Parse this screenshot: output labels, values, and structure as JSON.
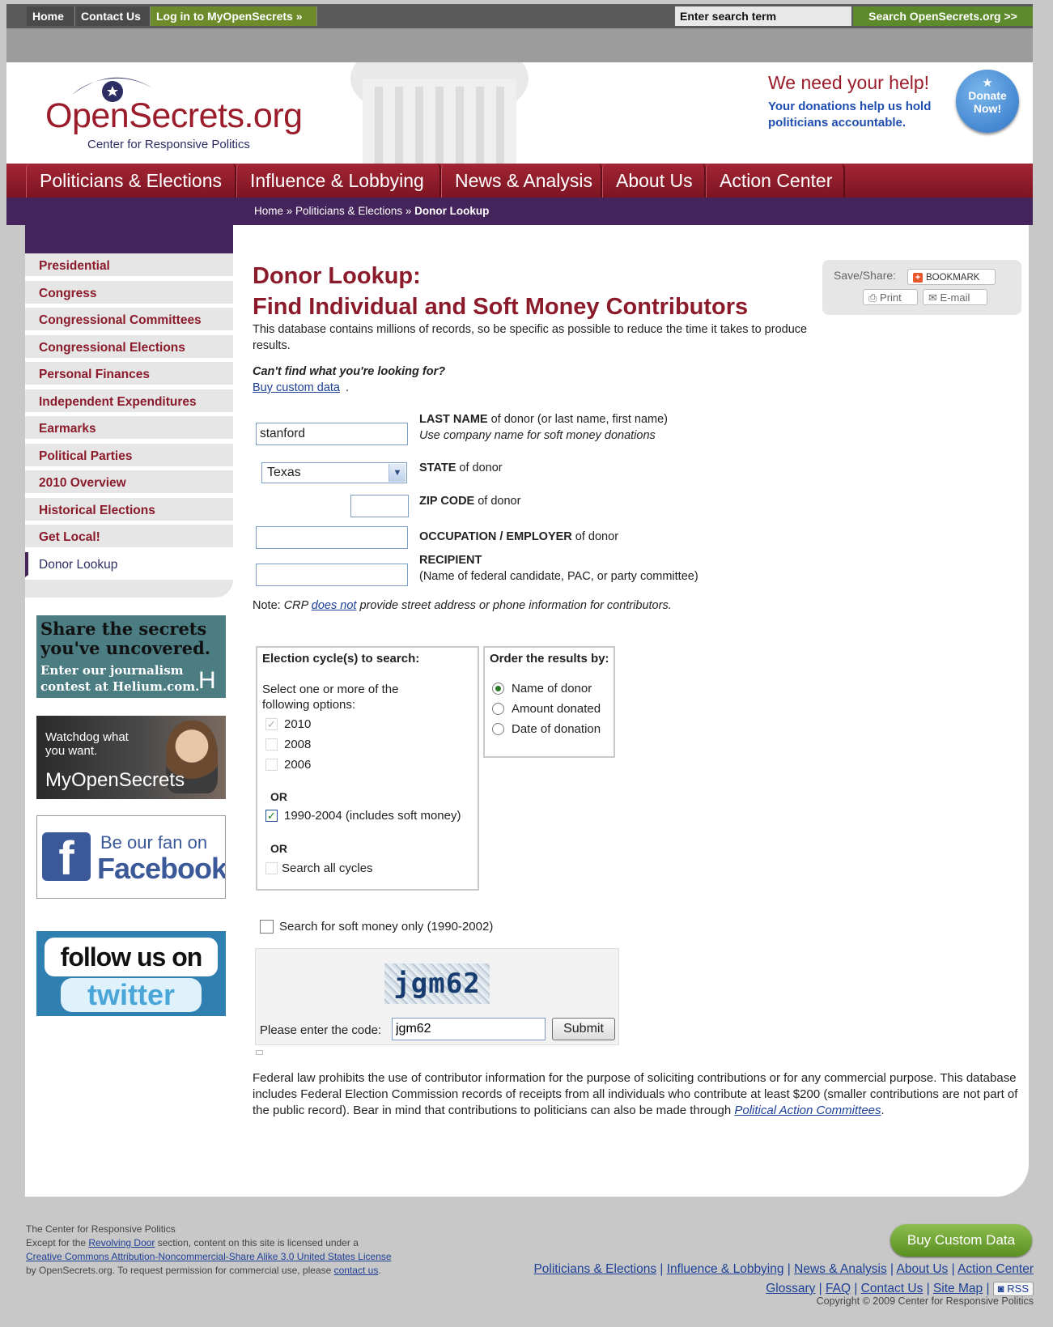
{
  "topbar": {
    "home": "Home",
    "contact": "Contact Us",
    "login": "Log in to MyOpenSecrets »",
    "search_value": "Enter search term",
    "search_button": "Search OpenSecrets.org >>"
  },
  "header": {
    "logo_name": "OpenSecrets.org",
    "logo_sub": "Center for Responsive Politics",
    "help_title": "We need your help!",
    "help_text": "Your donations help us hold politicians accountable.",
    "donate_1": "Donate",
    "donate_2": "Now!"
  },
  "mainnav": [
    "Politicians & Elections",
    "Influence & Lobbying",
    "News & Analysis",
    "About Us",
    "Action Center"
  ],
  "breadcrumb": {
    "home": "Home",
    "sep": " » ",
    "section": "Politicians & Elections",
    "current": "Donor Lookup"
  },
  "sidebar": [
    "Presidential",
    "Congress",
    "Congressional Committees",
    "Congressional Elections",
    "Personal Finances",
    "Independent Expenditures",
    "Earmarks",
    "Political Parties",
    "2010 Overview",
    "Historical Elections",
    "Get Local!",
    "Donor Lookup"
  ],
  "ads": {
    "helium_1": "Share the secrets",
    "helium_2": "you've uncovered.",
    "helium_3": "Enter our journalism",
    "helium_4": "contest at Helium.com.",
    "helium_logo": "H",
    "watch_1": "Watchdog what",
    "watch_2": "you want.",
    "watch_3": "MyOpenSecrets",
    "fb_letter": "f",
    "fb_1": "Be our fan on",
    "fb_2": "Facebook",
    "tw_1": "follow us on",
    "tw_2": "twitter"
  },
  "share": {
    "label": "Save/Share:",
    "bookmark": "BOOKMARK",
    "print": "Print",
    "email": "E-mail"
  },
  "page": {
    "title_1": "Donor Lookup:",
    "title_2": "Find Individual and Soft Money Contributors",
    "intro": "This database contains millions of records, so be specific as possible to reduce the time it takes to produce results.",
    "cant_find": "Can't find what you're looking for?",
    "buy_custom": "Buy custom data",
    "note_prefix": "Note: ",
    "note_1": "CRP ",
    "note_link": "does not",
    "note_2": " provide street address or phone information for contributors."
  },
  "form": {
    "last_name_value": "stanford",
    "last_name_label_b": "LAST NAME",
    "last_name_label": " of donor (or last name, first name)",
    "last_name_hint": "Use company name for soft money donations",
    "state_value": "Texas",
    "state_label_b": "STATE",
    "state_label": " of donor",
    "zip_value": "",
    "zip_label_b": "ZIP CODE",
    "zip_label": " of donor",
    "occ_value": "",
    "occ_label_b": "OCCUPATION / EMPLOYER",
    "occ_label": " of donor",
    "recip_value": "",
    "recip_label_b": "RECIPIENT",
    "recip_hint": "(Name of federal candidate, PAC, or party committee)"
  },
  "cycles": {
    "heading": "Election cycle(s) to search:",
    "instructions": "Select one or more of the following options:",
    "opt_2010": "2010",
    "opt_2008": "2008",
    "opt_2006": "2006",
    "or_1": "OR",
    "opt_1990": "1990-2004 (includes soft money)",
    "or_2": "OR",
    "opt_all": "Search all cycles"
  },
  "order": {
    "heading": "Order the results by:",
    "opt_name": "Name of donor",
    "opt_amount": "Amount donated",
    "opt_date": "Date of donation"
  },
  "soft_money": "Search for soft money only (1990-2002)",
  "captcha": {
    "image_text": "jgm62",
    "label": "Please enter the code:",
    "value": "jgm62",
    "submit": "Submit"
  },
  "federal": {
    "text": "Federal law prohibits the use of contributor information for the purpose of soliciting contributions or for any commercial purpose. This database includes Federal Election Commission records of receipts from all individuals who contribute at least $200 (smaller contributions are not part of the public record). Bear in mind that contributions to politicians can also be made through ",
    "link": "Political Action Committees",
    "end": "."
  },
  "footer": {
    "line1": "The Center for Responsive Politics",
    "line2_a": "Except for the ",
    "revolving": "Revolving Door",
    "line2_b": " section, content on this site is licensed under a",
    "license": "Creative Commons Attribution-Noncommercial-Share Alike 3.0 United States License",
    "line4_a": "by OpenSecrets.org. To request permission for commercial use, please ",
    "contact": "contact us",
    "line4_b": ".",
    "buy_button": "Buy Custom Data",
    "links_1": [
      "Politicians & Elections",
      "Influence & Lobbying",
      "News & Analysis",
      "About Us",
      "Action Center"
    ],
    "links_2": [
      "Glossary",
      "FAQ",
      "Contact Us",
      "Site Map"
    ],
    "sep": " | ",
    "rss": "RSS",
    "copyright": "Copyright © 2009 Center for Responsive Politics"
  },
  "colors": {
    "brand_red": "#9b1c2a",
    "nav_purple": "#44245a",
    "link_blue": "#1d3f96",
    "green": "#5d8a2b"
  }
}
